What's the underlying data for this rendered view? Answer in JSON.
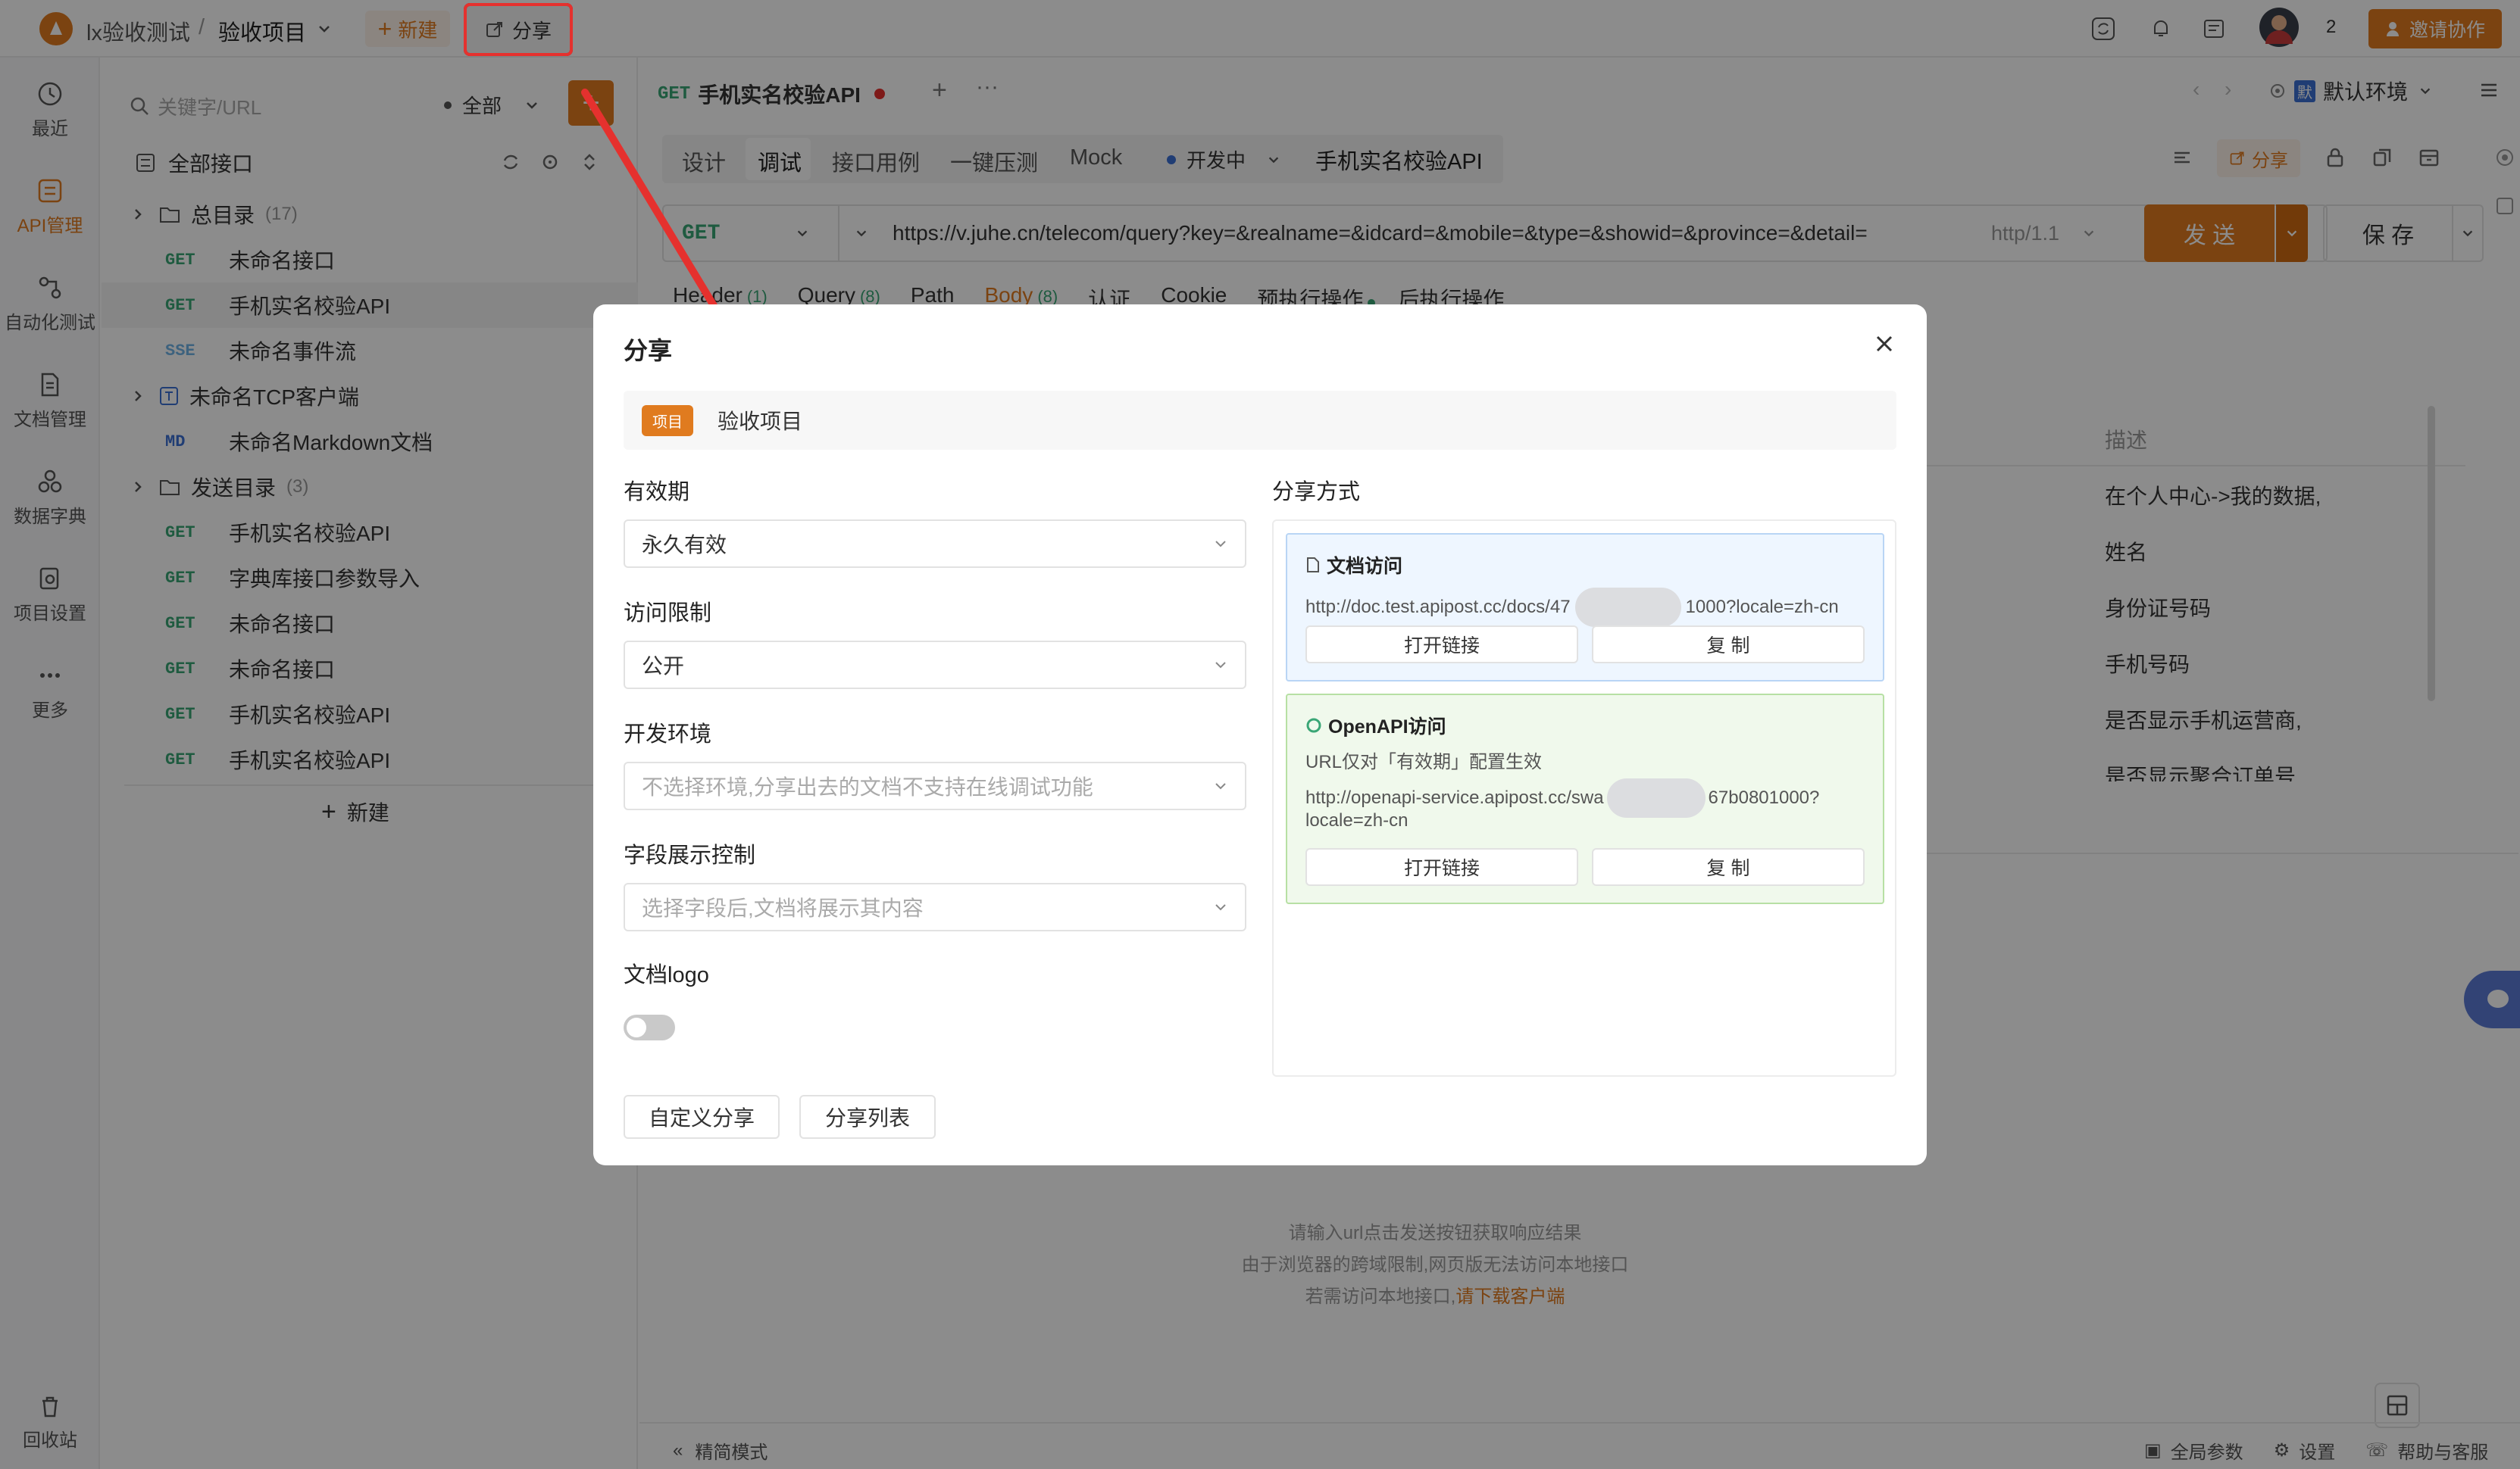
{
  "topbar": {
    "team": "lx验收测试",
    "separator": "/",
    "project": "验收项目",
    "new_label": "新建",
    "share_label": "分享",
    "member_count": "2",
    "invite_label": "邀请协作"
  },
  "rail": [
    {
      "label": "最近",
      "icon": "clock-icon"
    },
    {
      "label": "API管理",
      "icon": "api-icon"
    },
    {
      "label": "自动化测试",
      "icon": "automation-icon"
    },
    {
      "label": "文档管理",
      "icon": "document-icon"
    },
    {
      "label": "数据字典",
      "icon": "dictionary-icon"
    },
    {
      "label": "项目设置",
      "icon": "settings-icon"
    },
    {
      "label": "更多",
      "icon": "more-icon"
    }
  ],
  "rail_bottom": {
    "label": "回收站"
  },
  "tree": {
    "search_placeholder": "关键字/URL",
    "filter": "全部",
    "root_label": "全部接口",
    "new_label": "新建",
    "rows": [
      {
        "type": "folder",
        "label": "总目录",
        "count": "(17)"
      },
      {
        "type": "GET",
        "label": "未命名接口"
      },
      {
        "type": "GET",
        "label": "手机实名校验API"
      },
      {
        "type": "SSE",
        "label": "未命名事件流"
      },
      {
        "type": "tcp",
        "label": "未命名TCP客户端"
      },
      {
        "type": "MD",
        "label": "未命名Markdown文档"
      },
      {
        "type": "folder",
        "label": "发送目录",
        "count": "(3)"
      },
      {
        "type": "GET",
        "label": "手机实名校验API"
      },
      {
        "type": "GET",
        "label": "字典库接口参数导入"
      },
      {
        "type": "GET",
        "label": "未命名接口"
      },
      {
        "type": "GET",
        "label": "未命名接口"
      },
      {
        "type": "GET",
        "label": "手机实名校验API"
      },
      {
        "type": "GET",
        "label": "手机实名校验API"
      }
    ]
  },
  "main": {
    "tab_method": "GET",
    "tab_title": "手机实名校验API",
    "env": "默认环境",
    "subtabs": [
      "设计",
      "调试",
      "接口用例",
      "一键压测",
      "Mock"
    ],
    "status": "开发中",
    "api_name": "手机实名校验API",
    "share_label": "分享",
    "method": "GET",
    "url": "https://v.juhe.cn/telecom/query?key=&realname=&idcard=&mobile=&type=&showid=&province=&detail=",
    "protocol": "http/1.1",
    "send": "发 送",
    "save": "保 存",
    "param_tabs": [
      {
        "label": "Header",
        "count": "(1)"
      },
      {
        "label": "Query",
        "count": "(8)"
      },
      {
        "label": "Path",
        "count": ""
      },
      {
        "label": "Body",
        "count": "(8)"
      },
      {
        "label": "认证",
        "count": ""
      },
      {
        "label": "Cookie",
        "count": ""
      },
      {
        "label": "预执行操作",
        "count": ""
      },
      {
        "label": "后执行操作",
        "count": ""
      }
    ],
    "desc_header": "描述",
    "descriptions": [
      "在个人中心->我的数据,",
      "姓名",
      "身份证号码",
      "手机号码",
      "是否显示手机运营商,",
      "是否显示聚合订单号"
    ],
    "hint1": "请输入url点击发送按钮获取响应结果",
    "hint2": "由于浏览器的跨域限制,网页版无法访问本地接口",
    "hint3_prefix": "若需访问本地接口,",
    "hint3_link": "请下载客户端"
  },
  "footer": {
    "mode": "精简模式",
    "global_params": "全局参数",
    "settings": "设置",
    "help": "帮助与客服"
  },
  "modal": {
    "title": "分享",
    "badge": "项目",
    "project_name": "验收项目",
    "validity_label": "有效期",
    "validity_value": "永久有效",
    "access_label": "访问限制",
    "access_value": "公开",
    "env_label": "开发环境",
    "env_placeholder": "不选择环境,分享出去的文档不支持在线调试功能",
    "fields_label": "字段展示控制",
    "fields_placeholder": "选择字段后,文档将展示其内容",
    "logo_label": "文档logo",
    "logo_enabled": false,
    "custom_share": "自定义分享",
    "share_list": "分享列表",
    "method_label": "分享方式",
    "doc_card": {
      "title": "文档访问",
      "url_start": "http://doc.test.apipost.cc/docs/47",
      "url_end": "1000?locale=zh-cn",
      "open": "打开链接",
      "copy": "复 制"
    },
    "openapi_card": {
      "title": "OpenAPI访问",
      "note": "URL仅对「有效期」配置生效",
      "url_start": "http://openapi-service.apipost.cc/swa",
      "url_end": "67b0801000?",
      "url_line2": "locale=zh-cn",
      "open": "打开链接",
      "copy": "复 制"
    }
  },
  "colors": {
    "accent": "#e07b1f",
    "highlight_border": "#e5312e",
    "get": "#3aa676",
    "sse": "#6fb2e6",
    "md": "#3b6fd4",
    "doc_card_bg": "#eef6ff",
    "openapi_card_bg": "#f0f9ec"
  }
}
